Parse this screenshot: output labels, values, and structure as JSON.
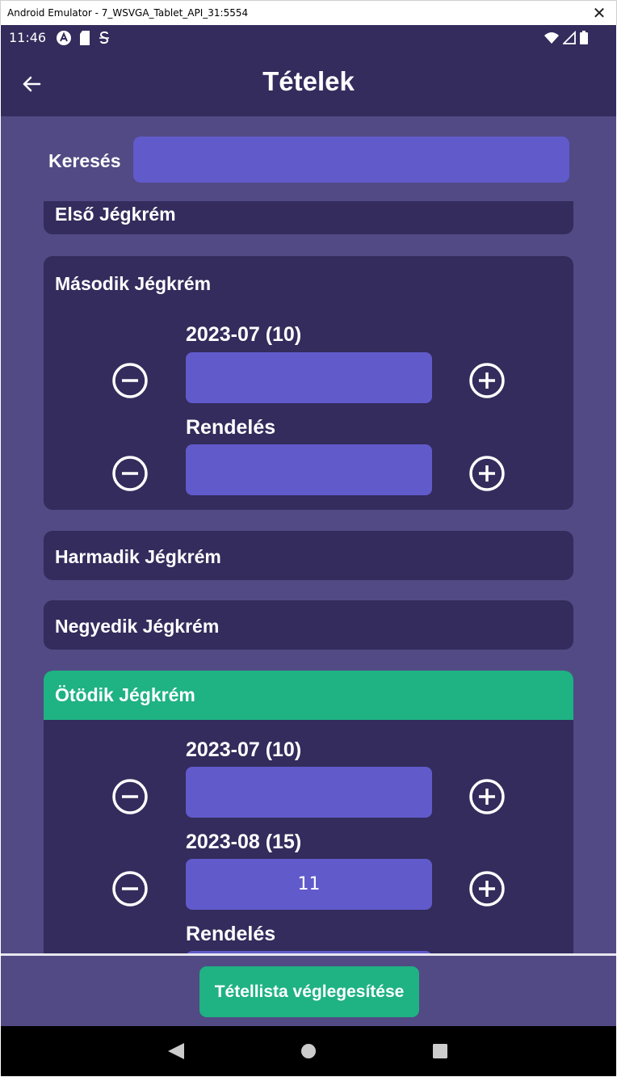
{
  "window": {
    "title": "Android Emulator - 7_WSVGA_Tablet_API_31:5554",
    "close_glyph": "✕"
  },
  "statusbar": {
    "time": "11:46",
    "icons": [
      "a-icon",
      "sd-card-icon",
      "s-icon"
    ],
    "right_icons": [
      "wifi-icon",
      "signal-icon",
      "battery-icon"
    ]
  },
  "appbar": {
    "title": "Tételek",
    "back_icon": "arrow-left-icon"
  },
  "search": {
    "label": "Keresés",
    "value": "",
    "placeholder": ""
  },
  "items": [
    {
      "name": "Első Jégkrém",
      "expanded": false,
      "selected": false
    },
    {
      "name": "Második Jégkrém",
      "expanded": true,
      "selected": false,
      "rows": [
        {
          "label": "2023-07 (10)",
          "value": ""
        },
        {
          "label": "Rendelés",
          "value": ""
        }
      ]
    },
    {
      "name": "Harmadik Jégkrém",
      "expanded": false,
      "selected": false
    },
    {
      "name": "Negyedik Jégkrém",
      "expanded": false,
      "selected": false
    },
    {
      "name": "Ötödik Jégkrém",
      "expanded": true,
      "selected": true,
      "rows": [
        {
          "label": "2023-07 (10)",
          "value": ""
        },
        {
          "label": "2023-08 (15)",
          "value": "11"
        },
        {
          "label": "Rendelés",
          "value": ""
        }
      ]
    }
  ],
  "footer": {
    "finalize_label": "Tétellista véglegesítése"
  },
  "colors": {
    "bar": "#332c5c",
    "background": "#524a84",
    "card": "#332c5c",
    "input": "#605acb",
    "accent_green": "#1fb283",
    "text": "#ffffff"
  }
}
